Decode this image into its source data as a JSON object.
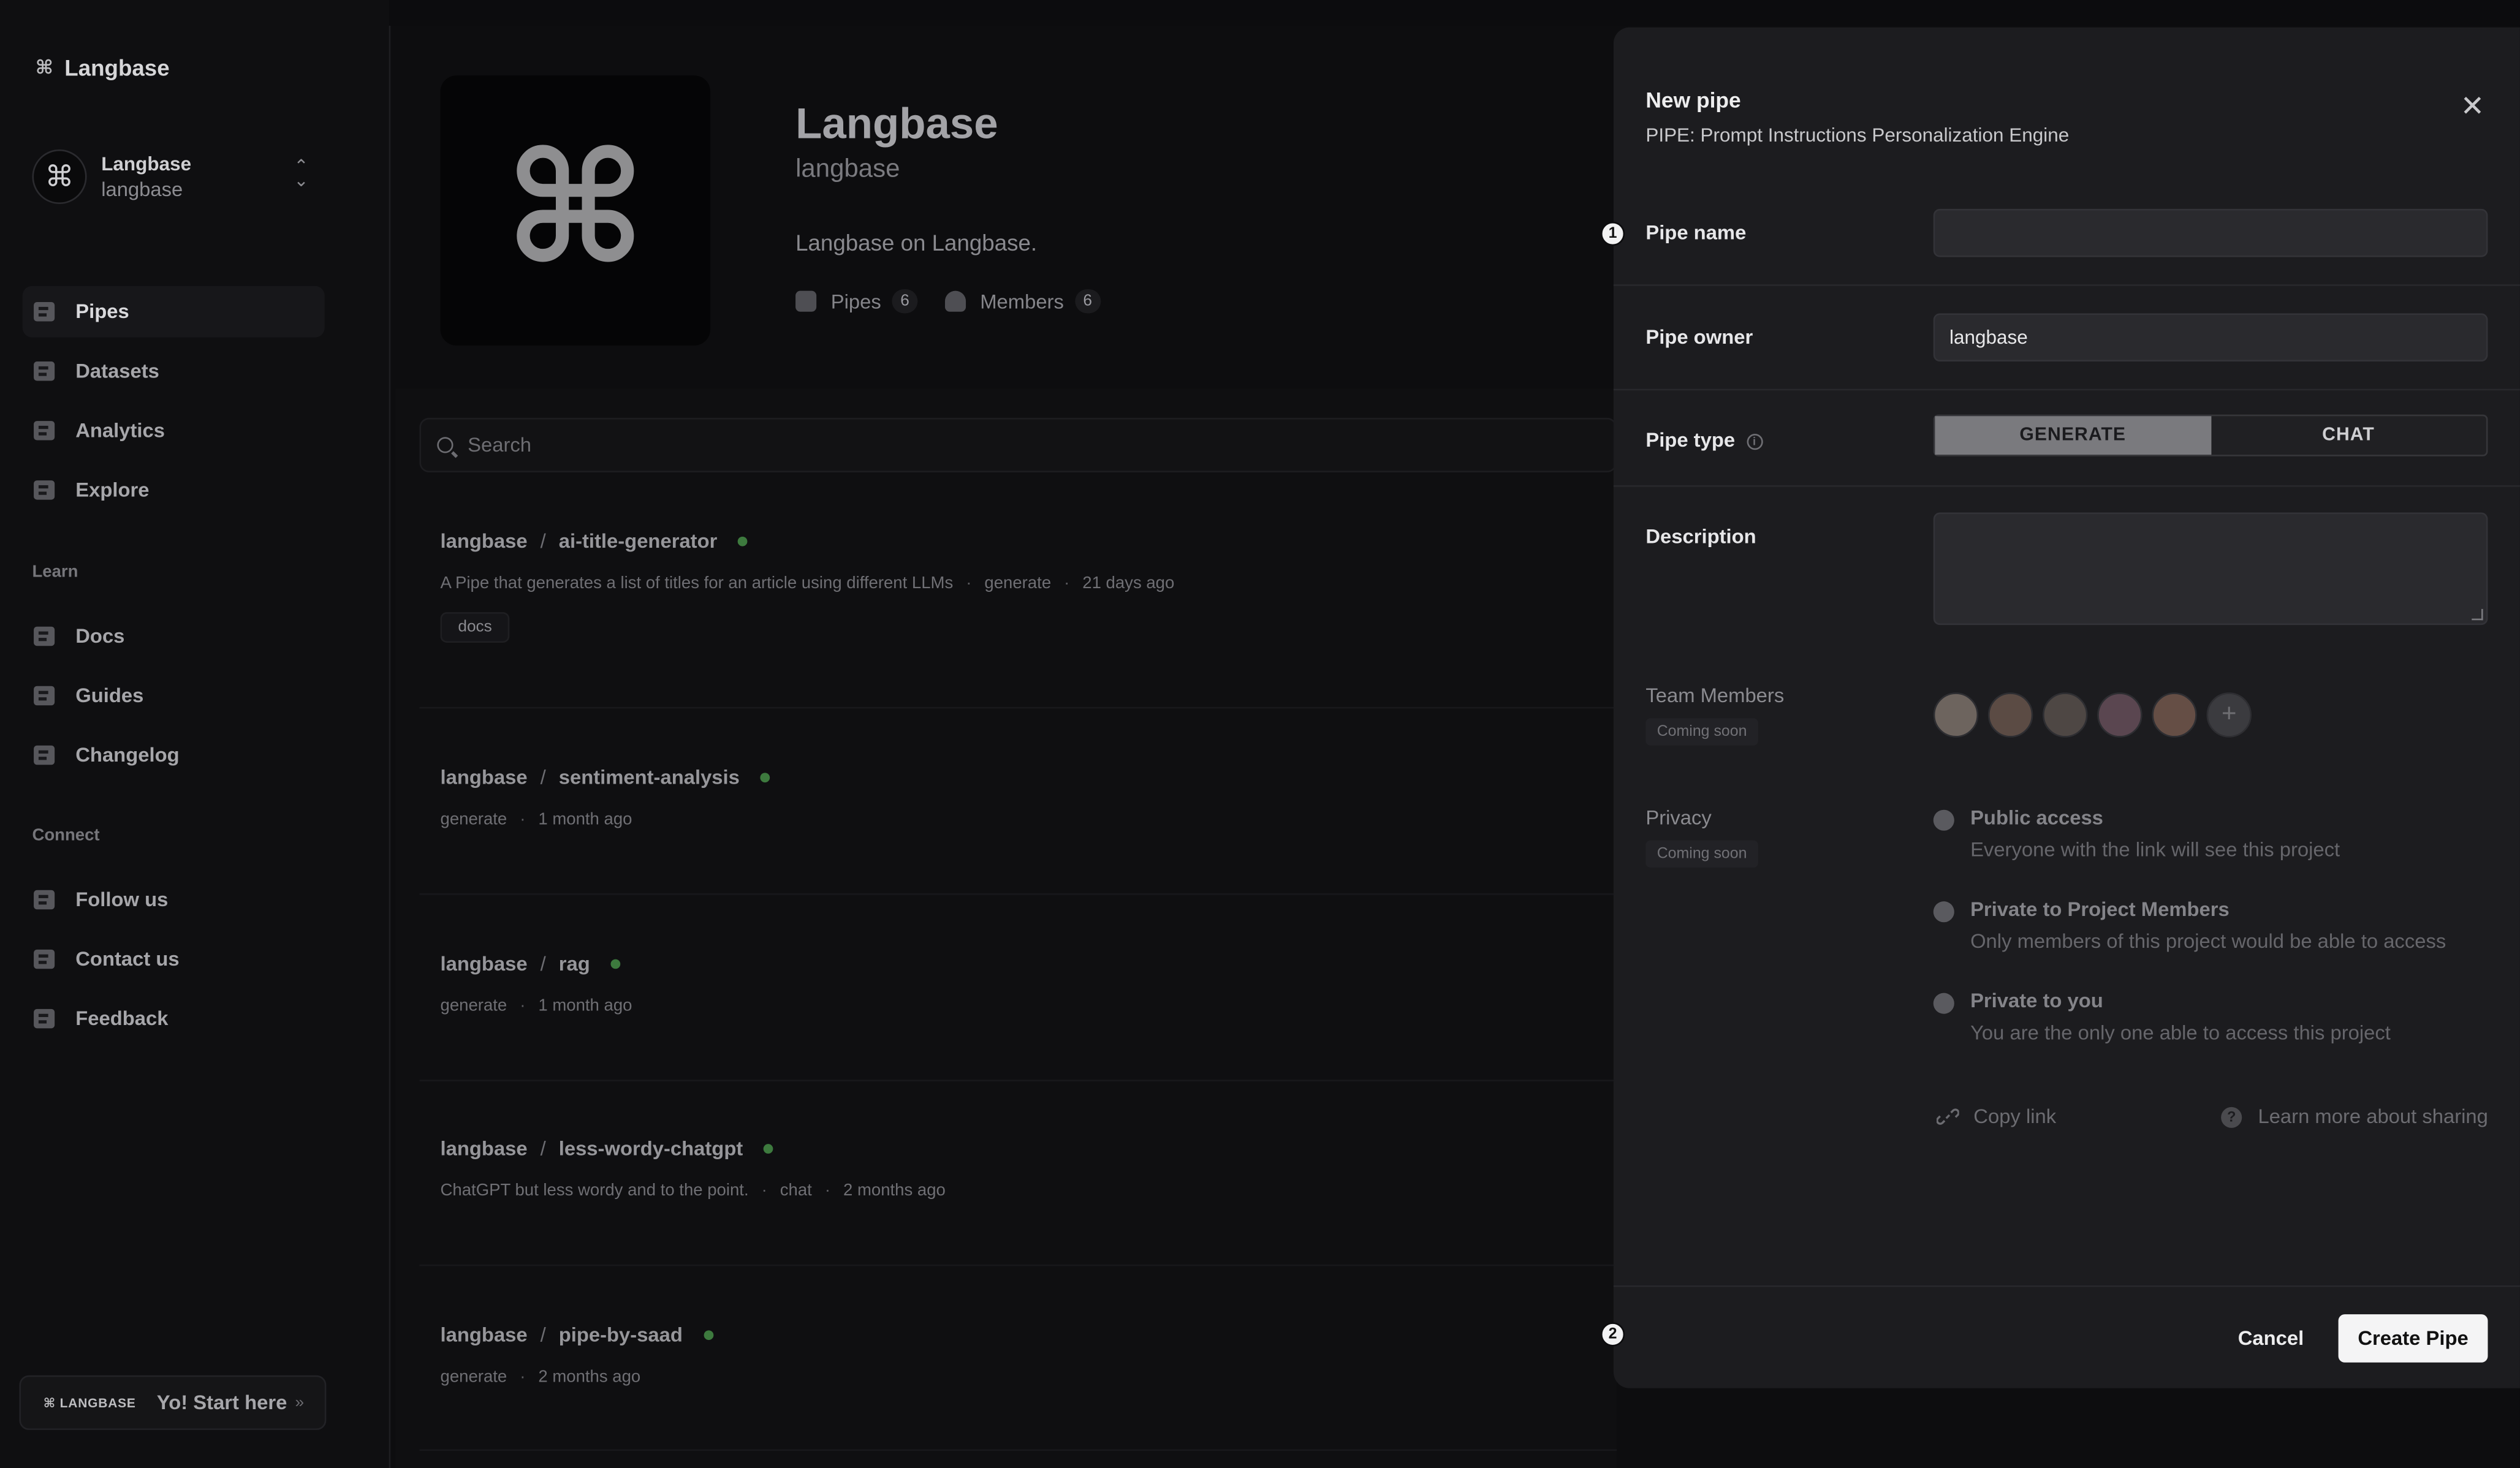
{
  "brand": {
    "glyph": "⌘",
    "name": "Langbase"
  },
  "account": {
    "avatar_glyph": "⌘",
    "name": "Langbase",
    "handle": "langbase",
    "toggle_glyph": "⌃⌄"
  },
  "sidebar": {
    "items": [
      {
        "label": "Pipes",
        "active": true
      },
      {
        "label": "Datasets"
      },
      {
        "label": "Analytics"
      },
      {
        "label": "Explore"
      }
    ],
    "learn_label": "Learn",
    "learn": [
      {
        "label": "Docs"
      },
      {
        "label": "Guides"
      },
      {
        "label": "Changelog"
      }
    ],
    "connect_label": "Connect",
    "connect": [
      {
        "label": "Follow us"
      },
      {
        "label": "Contact us"
      },
      {
        "label": "Feedback"
      }
    ],
    "start": {
      "logo": "⌘ LANGBASE",
      "label": "Yo! Start here",
      "arrow": "»"
    }
  },
  "profile": {
    "logo_glyph": "⌘",
    "title": "Langbase",
    "handle": "langbase",
    "description": "Langbase on Langbase.",
    "stats": [
      {
        "label": "Pipes",
        "count": "6",
        "icon": "cube-icon"
      },
      {
        "label": "Members",
        "count": "6",
        "icon": "person-icon"
      }
    ]
  },
  "search": {
    "placeholder": "Search"
  },
  "pipes": [
    {
      "owner": "langbase",
      "name": "ai-title-generator",
      "description": "A Pipe that generates a list of titles for an article using different LLMs",
      "type": "generate",
      "time": "21 days ago",
      "tag": "docs"
    },
    {
      "owner": "langbase",
      "name": "sentiment-analysis",
      "type": "generate",
      "time": "1 month ago"
    },
    {
      "owner": "langbase",
      "name": "rag",
      "type": "generate",
      "time": "1 month ago"
    },
    {
      "owner": "langbase",
      "name": "less-wordy-chatgpt",
      "description": "ChatGPT but less wordy and to the point.",
      "type": "chat",
      "time": "2 months ago"
    },
    {
      "owner": "langbase",
      "name": "pipe-by-saad",
      "type": "generate",
      "time": "2 months ago"
    }
  ],
  "modal": {
    "title": "New pipe",
    "subtitle": "PIPE: Prompt Instructions Personalization Engine",
    "close_glyph": "✕",
    "pipe_name_label": "Pipe name",
    "pipe_name_value": "",
    "pipe_owner_label": "Pipe owner",
    "pipe_owner_value": "langbase",
    "pipe_type_label": "Pipe type",
    "pipe_type_options": [
      "GENERATE",
      "CHAT"
    ],
    "pipe_type_selected": "GENERATE",
    "description_label": "Description",
    "team_label": "Team Members",
    "team_soon": "Coming soon",
    "privacy_label": "Privacy",
    "privacy_soon": "Coming soon",
    "privacy_options": [
      {
        "title": "Public access",
        "desc": "Everyone with the link will see this project"
      },
      {
        "title": "Private to Project Members",
        "desc": "Only members of this project would be able to access"
      },
      {
        "title": "Private to you",
        "desc": "You are the only one able to access this project"
      }
    ],
    "copy_link": "Copy link",
    "learn_more": "Learn more about sharing",
    "cancel": "Cancel",
    "create": "Create Pipe"
  },
  "annotations": [
    "1",
    "2"
  ],
  "colors": {
    "accent_dot": "#3d7a3e",
    "primary_button": "#f4f4f5",
    "modal_bg": "#1c1c1f"
  }
}
